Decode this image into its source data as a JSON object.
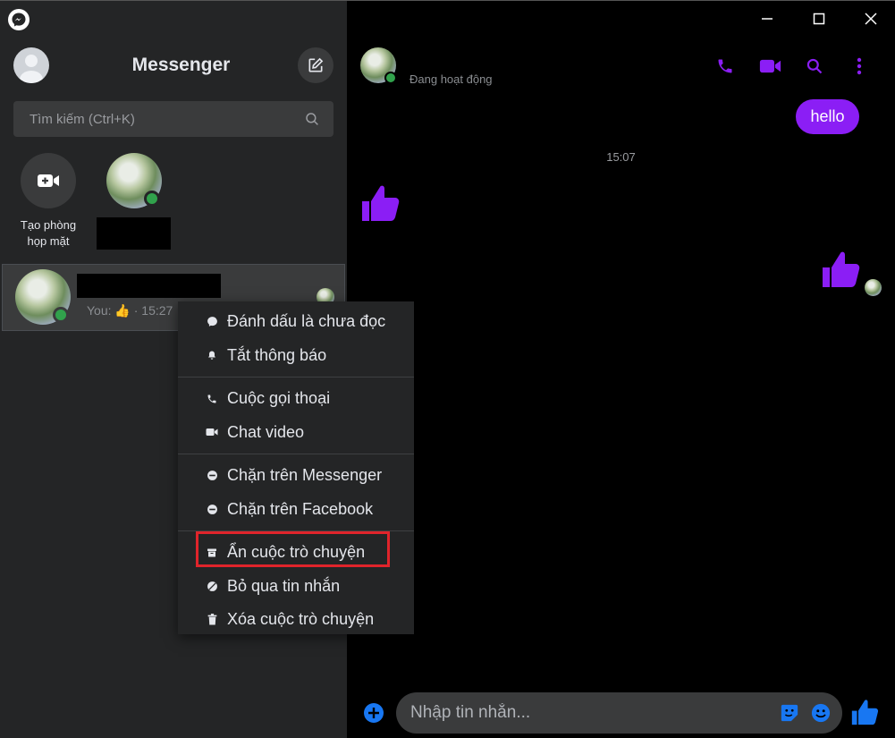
{
  "sidebar": {
    "title": "Messenger",
    "search_placeholder": "Tìm kiếm (Ctrl+K)",
    "create_room_label": "Tạo phòng họp mặt",
    "conversation": {
      "preview_prefix": "You:",
      "preview_emoji": "👍",
      "preview_sep": "·",
      "preview_time": "15:27"
    }
  },
  "context_menu": {
    "groups": [
      [
        {
          "label": "Đánh dấu là chưa đọc",
          "icon": "chat-bubble-icon"
        },
        {
          "label": "Tắt thông báo",
          "icon": "bell-icon"
        }
      ],
      [
        {
          "label": "Cuộc gọi thoại",
          "icon": "phone-icon"
        },
        {
          "label": "Chat video",
          "icon": "video-camera-icon"
        }
      ],
      [
        {
          "label": "Chặn trên Messenger",
          "icon": "block-icon"
        },
        {
          "label": "Chặn trên Facebook",
          "icon": "block-icon"
        }
      ],
      [
        {
          "label": "Ẩn cuộc trò chuyện",
          "icon": "archive-icon",
          "highlighted": true
        },
        {
          "label": "Bỏ qua tin nhắn",
          "icon": "ignore-icon"
        },
        {
          "label": "Xóa cuộc trò chuyện",
          "icon": "trash-icon"
        }
      ]
    ],
    "highlight_color": "#e0242b"
  },
  "chat": {
    "status": "Đang hoạt động",
    "messages": {
      "outgoing_text": "hello",
      "timestamp": "15:07"
    },
    "composer_placeholder": "Nhập tin nhắn..."
  },
  "colors": {
    "accent": "#8b1ef5",
    "online": "#31a24c",
    "composer_blue": "#1877f2"
  }
}
